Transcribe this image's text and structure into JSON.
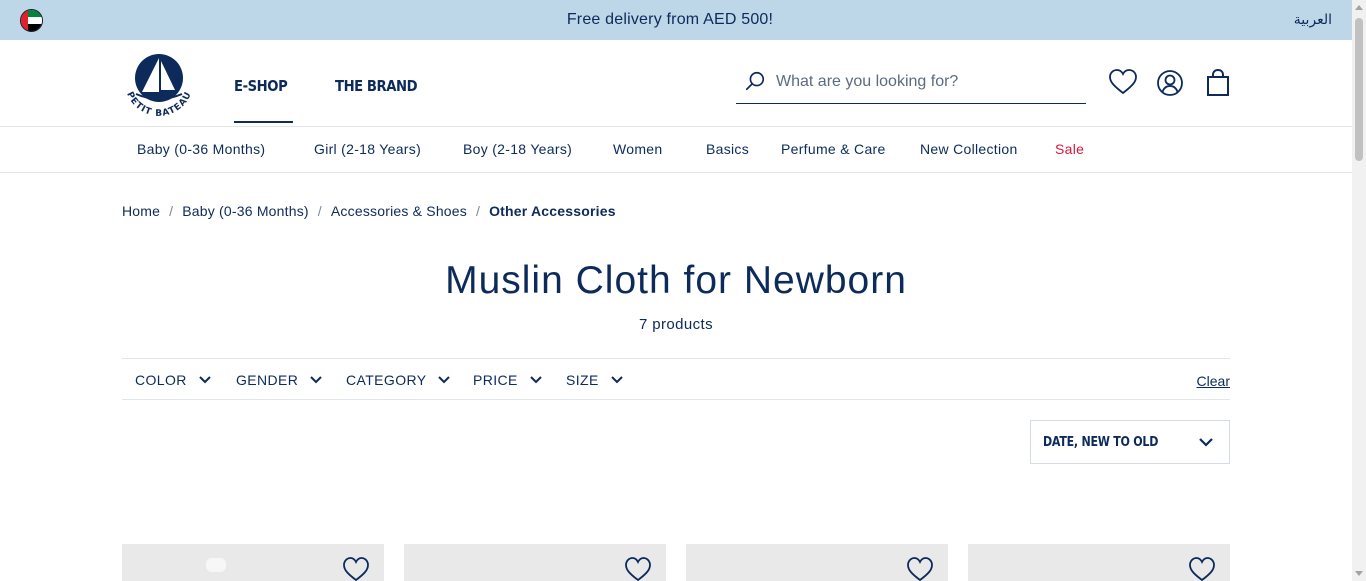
{
  "announcement": {
    "text": "Free delivery from AED 500!",
    "language_switch": "العربية",
    "flag_icon": "uae-flag-icon"
  },
  "header": {
    "logo_text": "PETIT BATEAU",
    "nav": [
      "E-SHOP",
      "THE BRAND"
    ],
    "active_nav": "E-SHOP",
    "search": {
      "placeholder": "What are you looking for?",
      "value": ""
    },
    "icons": [
      "wishlist-icon",
      "account-icon",
      "cart-icon"
    ]
  },
  "categories": [
    "Baby (0-36 Months)",
    "Girl (2-18 Years)",
    "Boy (2-18 Years)",
    "Women",
    "Basics",
    "Perfume & Care",
    "New Collection",
    "Sale"
  ],
  "breadcrumb": {
    "items": [
      "Home",
      "Baby (0-36 Months)",
      "Accessories & Shoes"
    ],
    "separator": "/",
    "current": "Other Accessories"
  },
  "page": {
    "title": "Muslin Cloth for Newborn",
    "count": "7 products"
  },
  "filters": {
    "items": [
      "COLOR",
      "GENDER",
      "CATEGORY",
      "PRICE",
      "SIZE"
    ],
    "clear": "Clear"
  },
  "sort": {
    "selected": "DATE, NEW TO OLD"
  },
  "products": [
    {
      "wishlist_icon": "heart-icon"
    },
    {
      "wishlist_icon": "heart-icon"
    },
    {
      "wishlist_icon": "heart-icon"
    },
    {
      "wishlist_icon": "heart-icon"
    }
  ],
  "colors": {
    "navy": "#0c2a5a",
    "announcement_bg": "#bdd6e8",
    "sale": "#d6183c",
    "card_bg": "#e9e9ea"
  }
}
